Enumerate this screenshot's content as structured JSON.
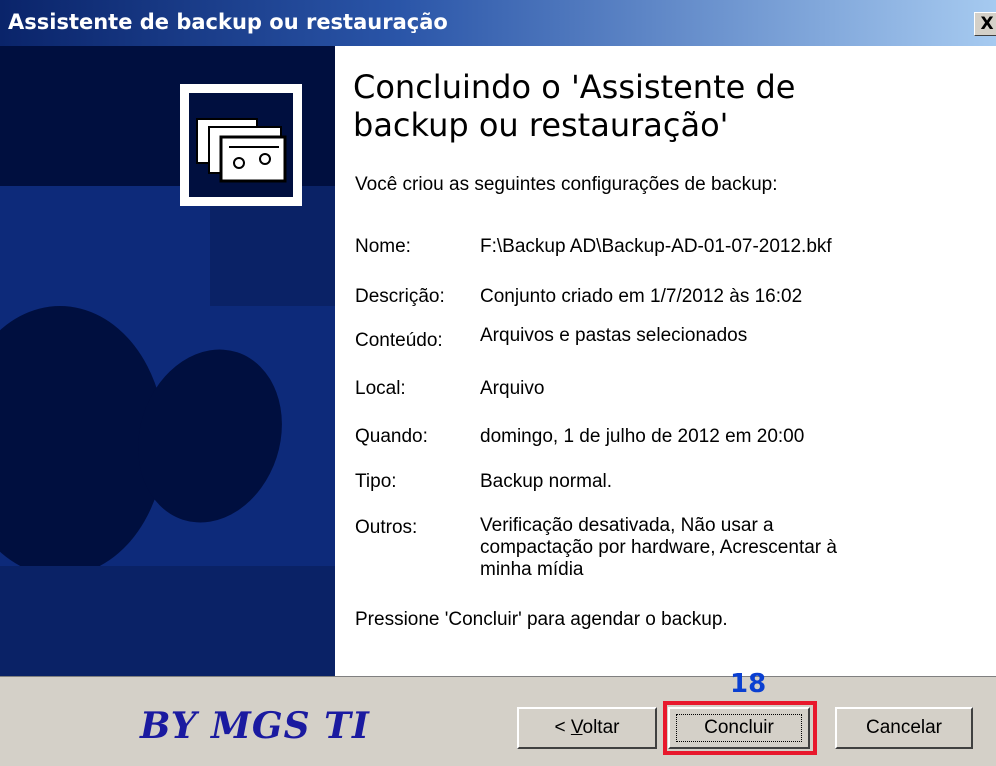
{
  "window": {
    "title": "Assistente de backup ou restauração",
    "close_label": "X"
  },
  "main": {
    "heading": "Concluindo o 'Assistente de backup ou restauração'",
    "intro": "Você criou as seguintes configurações de backup:",
    "rows": [
      {
        "label": "Nome:",
        "value": "F:\\Backup AD\\Backup-AD-01-07-2012.bkf"
      },
      {
        "label": "Descrição:",
        "value": "Conjunto criado em 1/7/2012 às 16:02"
      },
      {
        "label": "Conteúdo:",
        "value": "Arquivos e pastas selecionados"
      },
      {
        "label": "Local:",
        "value": "Arquivo"
      },
      {
        "label": "Quando:",
        "value": "domingo, 1 de julho de 2012 em 20:00"
      },
      {
        "label": "Tipo:",
        "value": "Backup normal."
      },
      {
        "label": "Outros:",
        "value": "Verificação desativada, Não usar a compactação por hardware, Acrescentar à minha mídia"
      }
    ],
    "footer_note": "Pressione 'Concluir' para agendar o backup."
  },
  "footer": {
    "brand": "BY MGS TI",
    "step_number": "18",
    "back_prefix": "< ",
    "back_accel": "V",
    "back_rest": "oltar",
    "finish_label": "Concluir",
    "cancel_label": "Cancelar"
  },
  "colors": {
    "titlebar": "#0a246a",
    "side_panel": "#000f3f",
    "dialog_face": "#d4d0c8",
    "highlight": "#e8182c",
    "step_number": "#0a3fd1",
    "brand": "#1a1aa0"
  },
  "icons": [
    "backup-tape-icon",
    "close-icon"
  ]
}
